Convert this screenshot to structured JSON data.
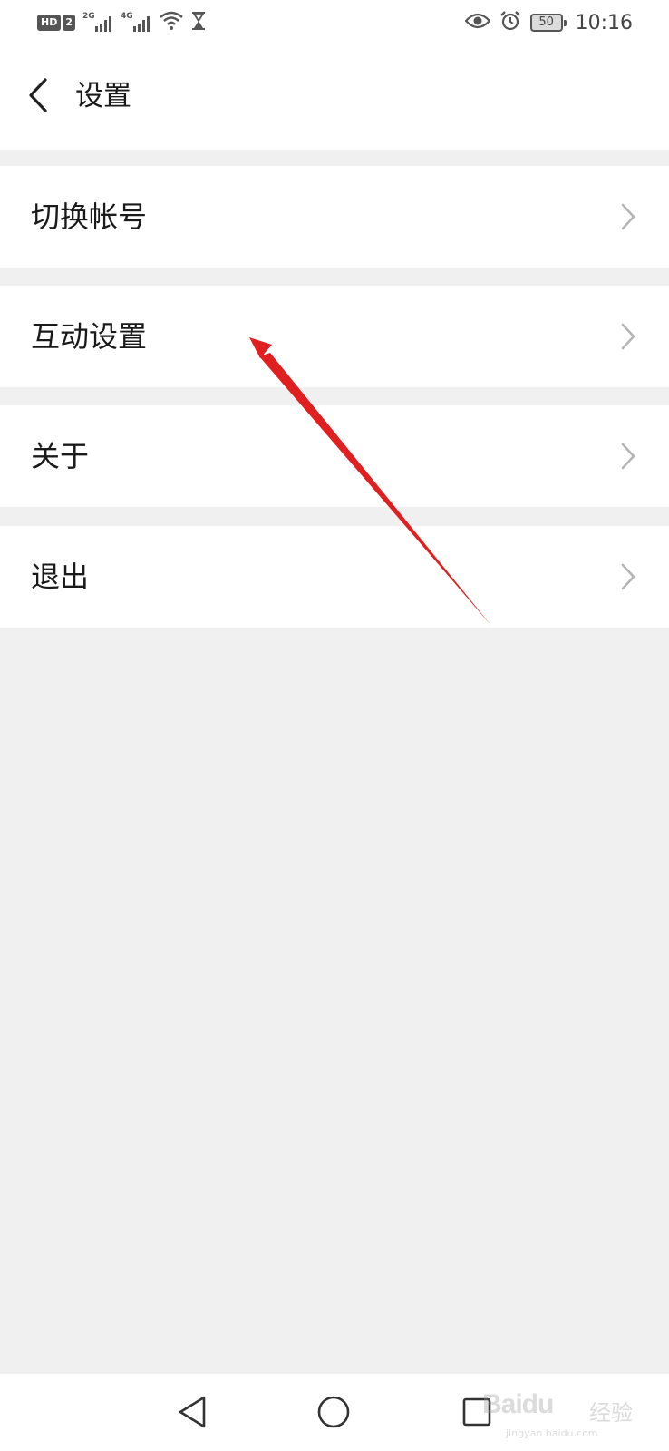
{
  "status_bar": {
    "hd_badge": "HD",
    "sim_badge": "2",
    "signal_1_gen": "2G",
    "signal_2_gen": "4G",
    "battery_level": "50",
    "time": "10:16"
  },
  "header": {
    "title": "设置"
  },
  "menu": {
    "items": [
      {
        "label": "切换帐号"
      },
      {
        "label": "互动设置"
      },
      {
        "label": "关于"
      },
      {
        "label": "退出"
      }
    ]
  },
  "watermark": {
    "logo": "Baidu",
    "cn": "经验",
    "url": "jingyan.baidu.com"
  },
  "colors": {
    "annotation_arrow": "#e02020",
    "background": "#f0f0f0",
    "surface": "#ffffff"
  }
}
